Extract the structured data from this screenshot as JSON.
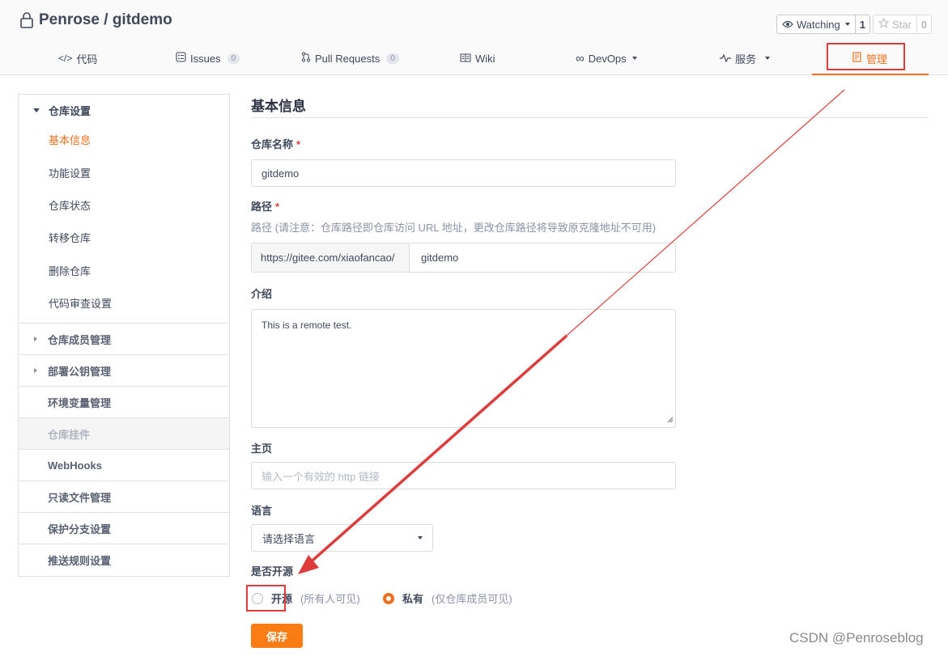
{
  "header": {
    "repo_title": "Penrose / gitdemo",
    "watch_label": "Watching",
    "watch_count": "1",
    "star_label": "Star",
    "star_count": "0"
  },
  "tabs": [
    {
      "label": "代码",
      "icon": "code-icon"
    },
    {
      "label": "Issues",
      "badge": "0",
      "icon": "issues-icon"
    },
    {
      "label": "Pull Requests",
      "badge": "0",
      "icon": "pull-request-icon"
    },
    {
      "label": "Wiki",
      "icon": "wiki-icon"
    },
    {
      "label": "DevOps",
      "icon": "infinity-icon"
    },
    {
      "label": "服务",
      "icon": "pulse-icon"
    },
    {
      "label": "管理",
      "icon": "manage-icon",
      "active": true
    }
  ],
  "sidebar": {
    "group_title": "仓库设置",
    "sub_items": [
      "基本信息",
      "功能设置",
      "仓库状态",
      "转移仓库",
      "删除仓库",
      "代码审查设置"
    ],
    "rows": [
      "仓库成员管理",
      "部署公钥管理",
      "环境变量管理",
      "仓库挂件",
      "WebHooks",
      "只读文件管理",
      "保护分支设置",
      "推送规则设置"
    ]
  },
  "main": {
    "title": "基本信息",
    "repo_name_label": "仓库名称",
    "repo_name_value": "gitdemo",
    "path_label": "路径",
    "path_hint": "路径 (请注意：仓库路径即仓库访问 URL 地址，更改仓库路径将导致原克隆地址不可用)",
    "path_prefix": "https://gitee.com/xiaofancao/",
    "path_value": "gitdemo",
    "intro_label": "介绍",
    "intro_value": "This is a remote test.",
    "homepage_label": "主页",
    "homepage_placeholder": "输入一个有效的 http 链接",
    "language_label": "语言",
    "language_value": "请选择语言",
    "open_source_label": "是否开源",
    "open_option_label": "开源",
    "open_option_desc": "(所有人可见)",
    "private_option_label": "私有",
    "private_option_desc": "(仅仓库成员可见)",
    "selected_visibility": "私有",
    "save_label": "保存"
  },
  "watermark": "CSDN @Penroseblog",
  "colors": {
    "accent": "#f06f1c",
    "save_button": "#fa7c14",
    "annotation": "#e03b3b"
  }
}
